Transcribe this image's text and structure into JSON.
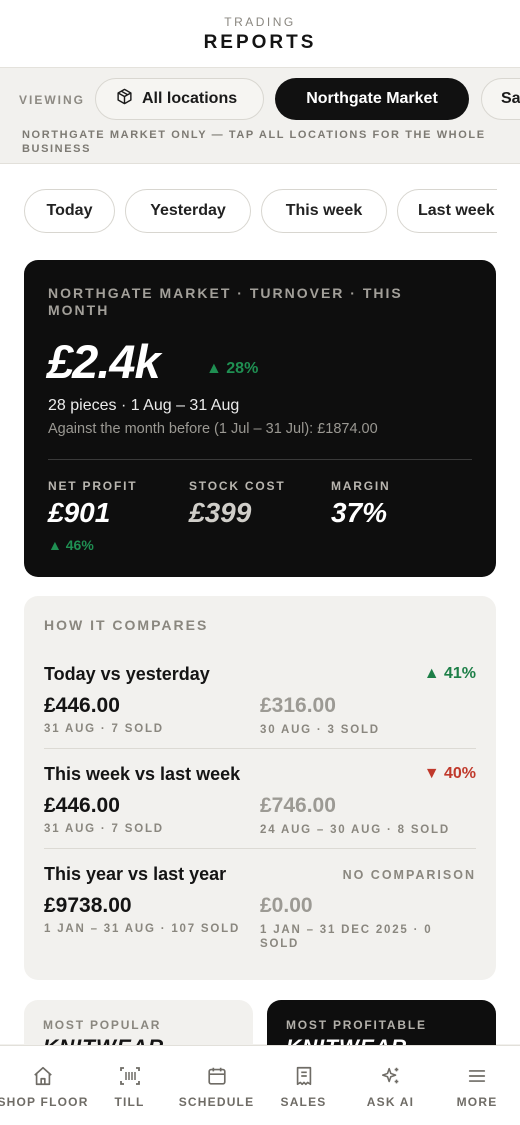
{
  "header": {
    "kicker": "TRADING",
    "title": "REPORTS"
  },
  "location_bar": {
    "viewing_label": "VIEWING",
    "options": [
      {
        "label": "All locations",
        "icon": "box-icon",
        "selected": false
      },
      {
        "label": "Northgate Market",
        "selected": true
      },
      {
        "label": "Sa",
        "selected": false
      }
    ],
    "hint": "NORTHGATE MARKET ONLY — TAP ALL LOCATIONS FOR THE WHOLE BUSINESS"
  },
  "periods": [
    {
      "label": "Today"
    },
    {
      "label": "Yesterday"
    },
    {
      "label": "This week"
    },
    {
      "label": "Last week"
    }
  ],
  "turnover": {
    "label": "NORTHGATE MARKET · TURNOVER · THIS MONTH",
    "value": "£2.4k",
    "change": "▲ 28%",
    "summary": "28 pieces · 1 Aug – 31 Aug",
    "comparison": "Against the month before (1 Jul – 31 Jul): £1874.00",
    "net_profit": {
      "label": "NET PROFIT",
      "value": "£901",
      "change": "▲ 46%"
    },
    "stock_cost": {
      "label": "STOCK COST",
      "value": "£399"
    },
    "margin": {
      "label": "MARGIN",
      "value": "37%"
    }
  },
  "compare": {
    "heading": "HOW IT COMPARES",
    "rows": [
      {
        "title": "Today vs yesterday",
        "change": "▲ 41%",
        "current": "£446.00",
        "current_meta": "31 AUG · 7 SOLD",
        "previous": "£316.00",
        "previous_meta": "30 AUG · 3 SOLD"
      },
      {
        "title": "This week vs last week",
        "change": "▼ 40%",
        "current": "£446.00",
        "current_meta": "31 AUG · 7 SOLD",
        "previous": "£746.00",
        "previous_meta": "24 AUG – 30 AUG · 8 SOLD"
      },
      {
        "title": "This year vs last year",
        "change": "NO COMPARISON",
        "current": "£9738.00",
        "current_meta": "1 JAN – 31 AUG · 107 SOLD",
        "previous": "£0.00",
        "previous_meta": "1 JAN – 31 DEC 2025 · 0 SOLD"
      }
    ]
  },
  "cards": {
    "most_popular": {
      "label": "MOST POPULAR",
      "value": "KNITWEAR"
    },
    "most_profitable": {
      "label": "MOST PROFITABLE",
      "value": "KNITWEAR"
    }
  },
  "tabbar": [
    {
      "label": "SHOP FLOOR",
      "icon": "home-icon"
    },
    {
      "label": "TILL",
      "icon": "barcode-scan-icon"
    },
    {
      "label": "SCHEDULE",
      "icon": "calendar-icon"
    },
    {
      "label": "SALES",
      "icon": "receipt-icon"
    },
    {
      "label": "ASK AI",
      "icon": "sparkle-icon"
    },
    {
      "label": "MORE",
      "icon": "menu-icon"
    }
  ],
  "colors": {
    "accent_dark": "#0e0e0e",
    "positive": "#1d7f47",
    "negative": "#c0392b",
    "background": "#f2f1ee"
  }
}
